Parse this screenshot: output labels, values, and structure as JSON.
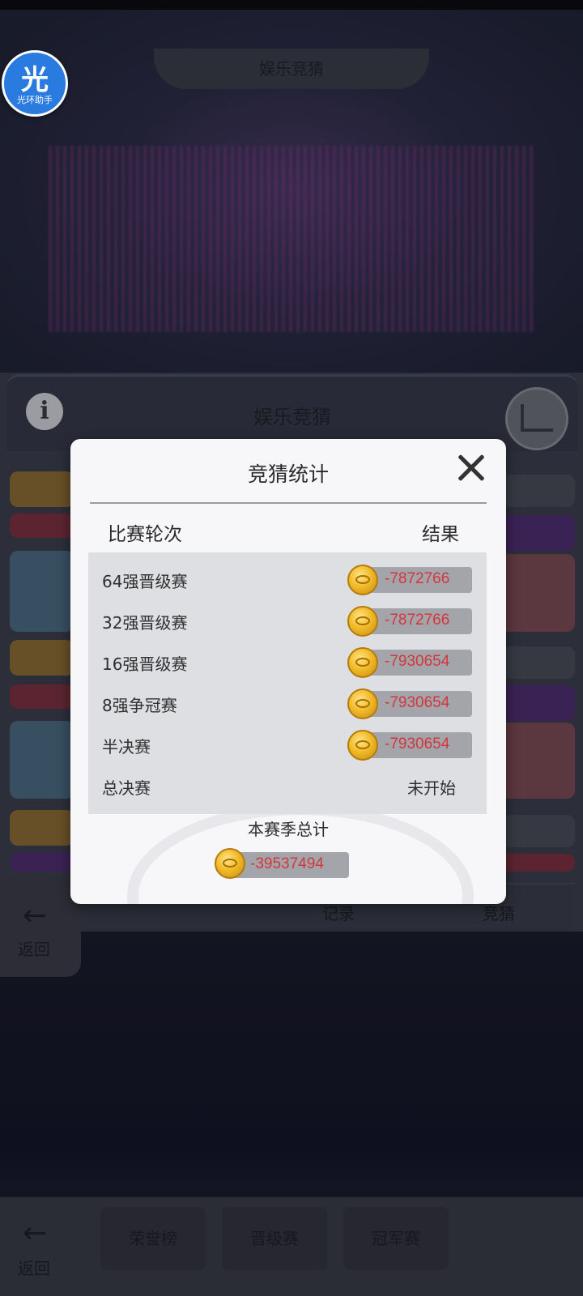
{
  "background": {
    "top_title": "娱乐竞猜",
    "panel_title": "娱乐竞猜",
    "tabs": [
      "记录",
      "竞猜"
    ],
    "back_label": "返回",
    "nav_back_label": "返回",
    "nav_buttons": [
      "荣誉榜",
      "晋级赛",
      "冠军赛"
    ]
  },
  "helper": {
    "glyph": "光",
    "label": "光环助手"
  },
  "dialog": {
    "title": "竞猜统计",
    "columns": {
      "round": "比赛轮次",
      "result": "结果"
    },
    "rows": [
      {
        "round": "64强晋级赛",
        "value": "-7872766"
      },
      {
        "round": "32强晋级赛",
        "value": "-7872766"
      },
      {
        "round": "16强晋级赛",
        "value": "-7930654"
      },
      {
        "round": "8强争冠赛",
        "value": "-7930654"
      },
      {
        "round": "半决赛",
        "value": "-7930654"
      },
      {
        "round": "总决赛",
        "status": "未开始"
      }
    ],
    "season_total_label": "本赛季总计",
    "season_total_value": "-39537494"
  },
  "colors": {
    "negative_value": "#d2373c",
    "coin_gold": "#f1bb2a",
    "helper_blue": "#2a7be0"
  },
  "icons": {
    "close": "close-icon",
    "coin": "gold-coin-icon",
    "info": "info-icon",
    "stats": "chart-icon",
    "back": "back-arrow-icon"
  }
}
